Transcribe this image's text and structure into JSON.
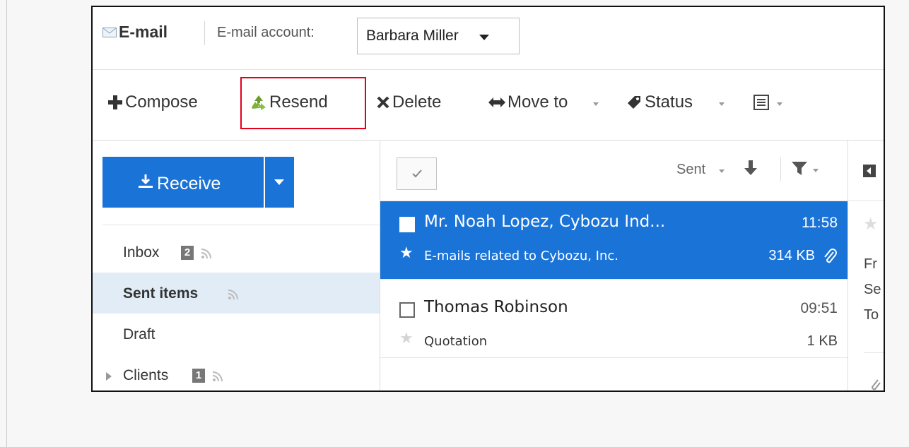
{
  "header": {
    "app_icon": "envelope-icon",
    "app_title": "E-mail",
    "account_label": "E-mail account:",
    "account_value": "Barbara Miller"
  },
  "toolbar": {
    "compose": "Compose",
    "resend": "Resend",
    "delete": "Delete",
    "move_to": "Move to",
    "status": "Status",
    "menu_icon": "list-menu-icon"
  },
  "sidebar": {
    "receive": "Receive",
    "folders": [
      {
        "label": "Inbox",
        "badge": "2"
      },
      {
        "label": "Sent items"
      },
      {
        "label": "Draft"
      },
      {
        "label": "Clients",
        "badge": "1"
      }
    ]
  },
  "list": {
    "sort_label": "Sent",
    "messages": [
      {
        "from": "Mr. Noah Lopez, Cybozu Ind...",
        "time": "11:58",
        "subject": "E-mails related to Cybozu, Inc.",
        "size": "314 KB"
      },
      {
        "from": "Thomas Robinson",
        "time": "09:51",
        "subject": "Quotation",
        "size": "1 KB"
      }
    ]
  },
  "preview": {
    "lines": [
      "Fr",
      "Se",
      "To"
    ]
  },
  "colors": {
    "accent": "#1a73d7",
    "highlight": "#e3001b",
    "selected_folder_bg": "#e2ecf7"
  }
}
